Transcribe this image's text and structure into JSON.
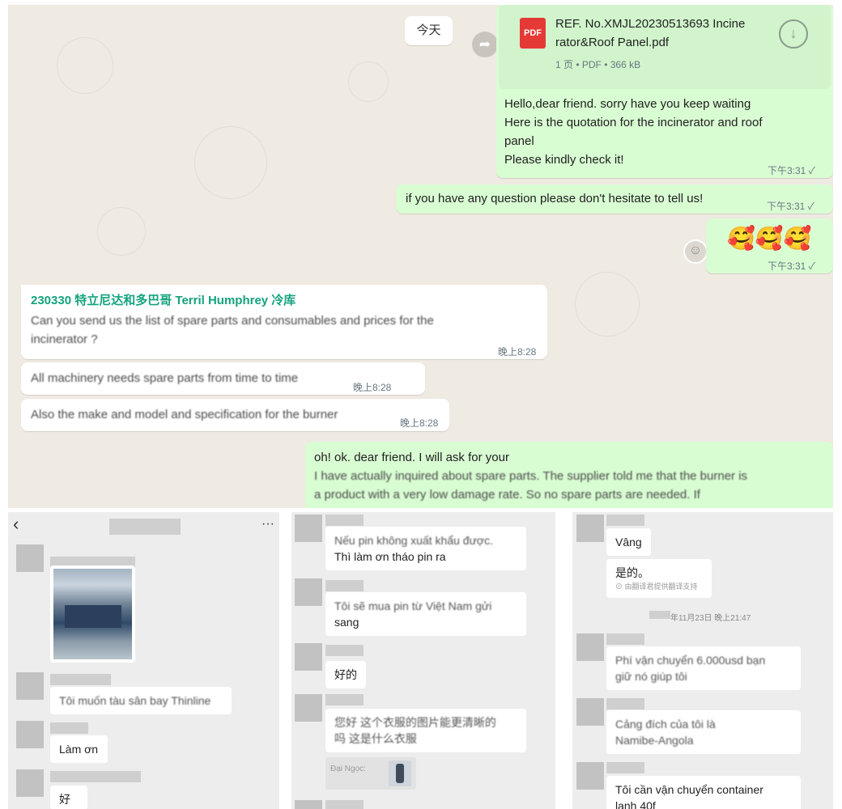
{
  "whatsapp": {
    "date_chip": "今天",
    "pdf": {
      "icon_label": "PDF",
      "filename_line1": "REF. No.XMJL20230513693 Incine",
      "filename_line2": "rator&Roof Panel.pdf",
      "meta": "1 页 • PDF • 366 kB"
    },
    "msg_out_1": {
      "line1": "Hello,dear friend. sorry have you keep waiting",
      "line2": "Here is the quotation for the incinerator and roof",
      "line3": "panel",
      "line4": "Please kindly check it!",
      "time": "下午3:31"
    },
    "msg_out_2": {
      "text": "if you have any question please don't hesitate to tell us!",
      "time": "下午3:31"
    },
    "msg_out_3": {
      "emoji": "🥰🥰🥰",
      "time": "下午3:31"
    },
    "msg_in_1": {
      "sender": "230330 特立尼达和多巴哥 Terril Humphrey 冷库",
      "line1": "Can you send us the list of spare parts and consumables and prices for the",
      "line2": "incinerator ?",
      "time": "晚上8:28"
    },
    "msg_in_2": {
      "text": "All machinery needs spare parts from time to time",
      "time": "晚上8:28"
    },
    "msg_in_3": {
      "text": "Also the make and model and specification for the burner",
      "time": "晚上8:28"
    },
    "msg_out_4": {
      "line1": "oh! ok. dear friend. I will ask for your",
      "line2": "I have actually inquired about spare parts. The supplier told me that the burner is",
      "line3": "a product with a very low damage rate. So no spare parts are needed. If"
    },
    "check_mark": "✓",
    "forward_icon": "➦",
    "download_icon": "↓",
    "react_icon": "☺"
  },
  "wechat_left": {
    "back_icon": "‹",
    "more_icon": "···",
    "msg_1": "Tôi muốn tàu sân bay Thinline",
    "msg_2": "Làm ơn",
    "msg_3": "好的"
  },
  "wechat_mid": {
    "msg_1_line1": "Nếu pin không xuất khẩu được.",
    "msg_1_line2": "Thì làm ơn tháo pin ra",
    "msg_2_line1": "Tôi sẽ mua pin từ Việt Nam gửi",
    "msg_2_line2": "sang",
    "msg_3": "好的",
    "msg_4_line1": "您好 这个衣服的图片能更清晰的",
    "msg_4_line2": "吗 这是什么衣服",
    "quote_label": "Đại Ngọc:"
  },
  "wechat_right": {
    "msg_1": "Vâng",
    "msg_2": "是的。",
    "translate_note": "由翻译君提供翻译支持",
    "timestamp": "年11月23日 晚上21:47",
    "msg_3_line1": "Phí vận chuyển 6.000usd bạn",
    "msg_3_line2": "giữ nó giúp tôi",
    "msg_4_line1": "Cảng đích của tôi là",
    "msg_4_line2": "Namibe-Angola",
    "msg_5_line1": "Tôi cần vận chuyển container",
    "msg_5_line2": "lạnh 40f"
  }
}
